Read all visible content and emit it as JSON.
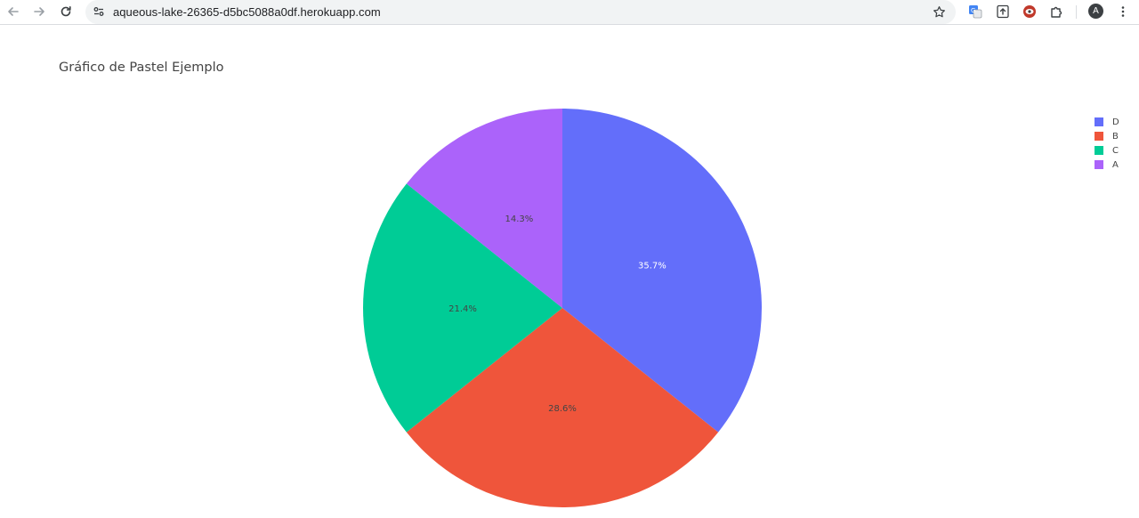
{
  "browser": {
    "url": "aqueous-lake-26365-d5bc5088a0df.herokuapp.com",
    "profile_initial": "A"
  },
  "chart_data": {
    "type": "pie",
    "title": "Gráfico de Pastel Ejemplo",
    "categories": [
      "D",
      "B",
      "C",
      "A"
    ],
    "values": [
      5,
      4,
      3,
      2
    ],
    "percent_labels": [
      "35.7%",
      "28.6%",
      "21.4%",
      "14.3%"
    ],
    "colors": [
      "#636efa",
      "#ef553b",
      "#00cc96",
      "#ab63fa"
    ],
    "direction": "clockwise",
    "start": "12 o'clock",
    "legend_position": "top-right",
    "legend_order": [
      "D",
      "B",
      "C",
      "A"
    ]
  }
}
